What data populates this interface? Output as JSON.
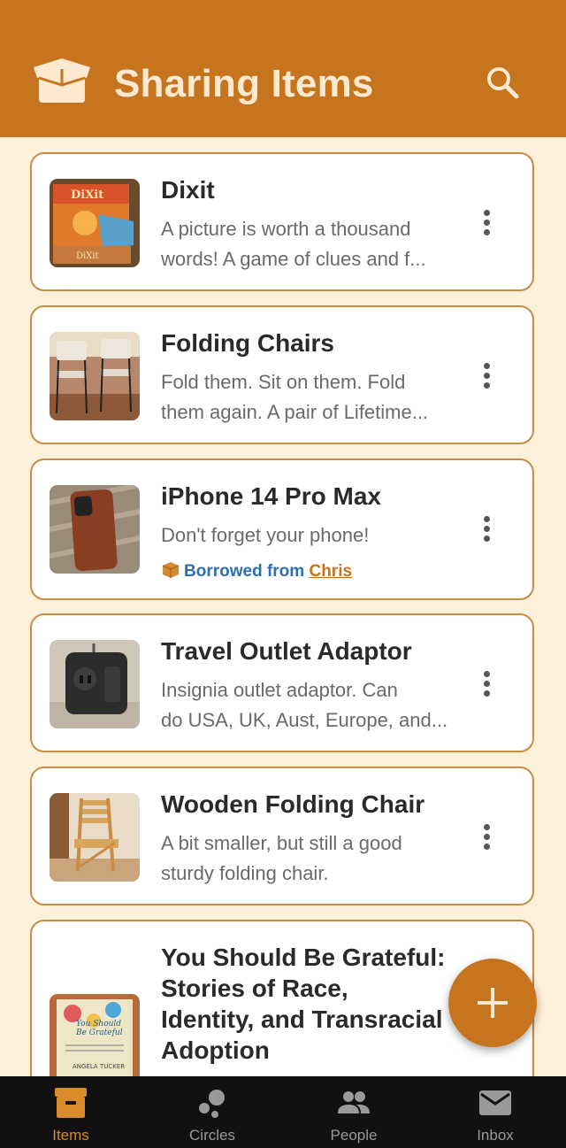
{
  "app": {
    "title": "Sharing Items",
    "accent": "#c6741d",
    "icons": {
      "logo": "open-box-icon",
      "search": "search-icon"
    }
  },
  "items": [
    {
      "name": "Dixit",
      "desc1": "A picture is worth a thousand",
      "desc2": "words! A game of clues and f..."
    },
    {
      "name": "Folding Chairs",
      "desc1": "Fold them. Sit on them. Fold",
      "desc2": "them again. A pair of Lifetime..."
    },
    {
      "name": "iPhone 14 Pro Max",
      "desc1": "Don't forget your phone!",
      "borrow_prefix": "Borrowed from",
      "borrow_owner": "Chris"
    },
    {
      "name": "Travel Outlet Adaptor",
      "desc1": "Insignia outlet adaptor. Can",
      "desc2": "do USA, UK, Aust, Europe, and..."
    },
    {
      "name": "Wooden Folding Chair",
      "desc1": "A bit smaller, but still a good",
      "desc2": "sturdy folding chair."
    },
    {
      "name_lines": [
        "You Should Be Grateful:",
        "Stories of Race,",
        "Identity, and Transracial",
        "Adoption"
      ]
    }
  ],
  "nav": {
    "tabs": [
      {
        "label": "Items",
        "icon": "archive-icon",
        "active": true
      },
      {
        "label": "Circles",
        "icon": "circles-icon",
        "active": false
      },
      {
        "label": "People",
        "icon": "people-icon",
        "active": false
      },
      {
        "label": "Inbox",
        "icon": "mail-icon",
        "active": false
      }
    ]
  },
  "fab": {
    "icon": "plus-icon"
  }
}
